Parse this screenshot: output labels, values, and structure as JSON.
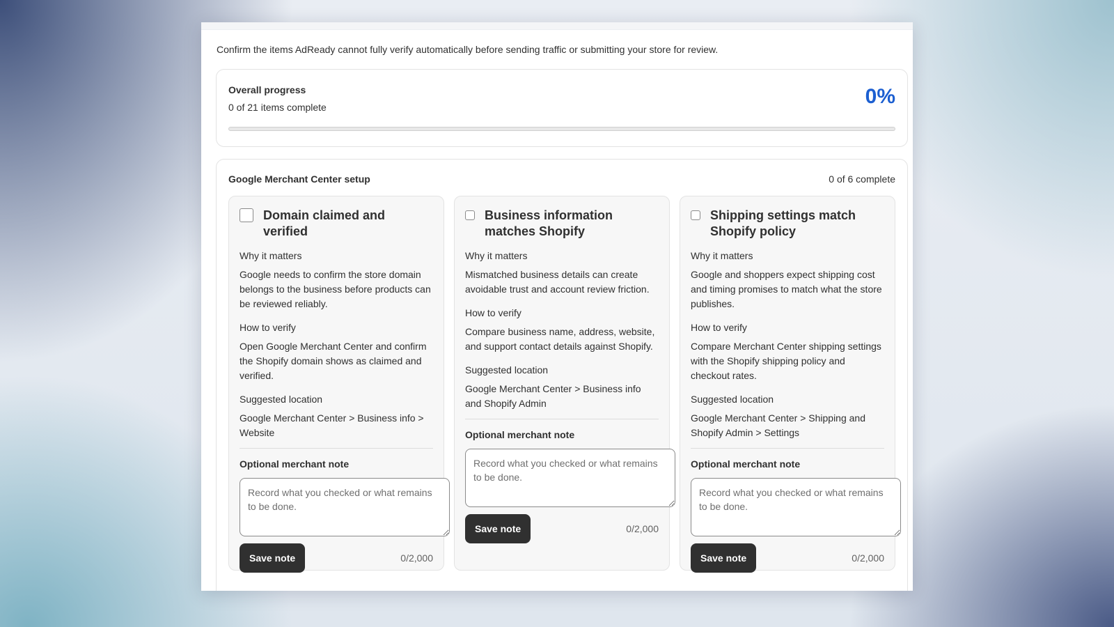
{
  "intro": "Confirm the items AdReady cannot fully verify automatically before sending traffic or submitting your store for review.",
  "progress": {
    "title": "Overall progress",
    "count": "0 of 21 items complete",
    "percent_label": "0%",
    "percent_value": 0
  },
  "section": {
    "title": "Google Merchant Center setup",
    "count": "0 of 6 complete",
    "items": [
      {
        "title": "Domain claimed and verified",
        "why_label": "Why it matters",
        "why_text": "Google needs to confirm the store domain belongs to the business before products can be reviewed reliably.",
        "how_label": "How to verify",
        "how_text": "Open Google Merchant Center and confirm the Shopify domain shows as claimed and verified.",
        "loc_label": "Suggested location",
        "loc_text": "Google Merchant Center > Business info > Website",
        "note_label": "Optional merchant note",
        "note_placeholder": "Record what you checked or what remains to be done.",
        "save_label": "Save note",
        "counter": "0/2,000"
      },
      {
        "title": "Business information matches Shopify",
        "why_label": "Why it matters",
        "why_text": "Mismatched business details can create avoidable trust and account review friction.",
        "how_label": "How to verify",
        "how_text": "Compare business name, address, website, and support contact details against Shopify.",
        "loc_label": "Suggested location",
        "loc_text": "Google Merchant Center > Business info and Shopify Admin",
        "note_label": "Optional merchant note",
        "note_placeholder": "Record what you checked or what remains to be done.",
        "save_label": "Save note",
        "counter": "0/2,000"
      },
      {
        "title": "Shipping settings match Shopify policy",
        "why_label": "Why it matters",
        "why_text": "Google and shoppers expect shipping cost and timing promises to match what the store publishes.",
        "how_label": "How to verify",
        "how_text": "Compare Merchant Center shipping settings with the Shopify shipping policy and checkout rates.",
        "loc_label": "Suggested location",
        "loc_text": "Google Merchant Center > Shipping and Shopify Admin > Settings",
        "note_label": "Optional merchant note",
        "note_placeholder": "Record what you checked or what remains to be done.",
        "save_label": "Save note",
        "counter": "0/2,000"
      }
    ]
  }
}
